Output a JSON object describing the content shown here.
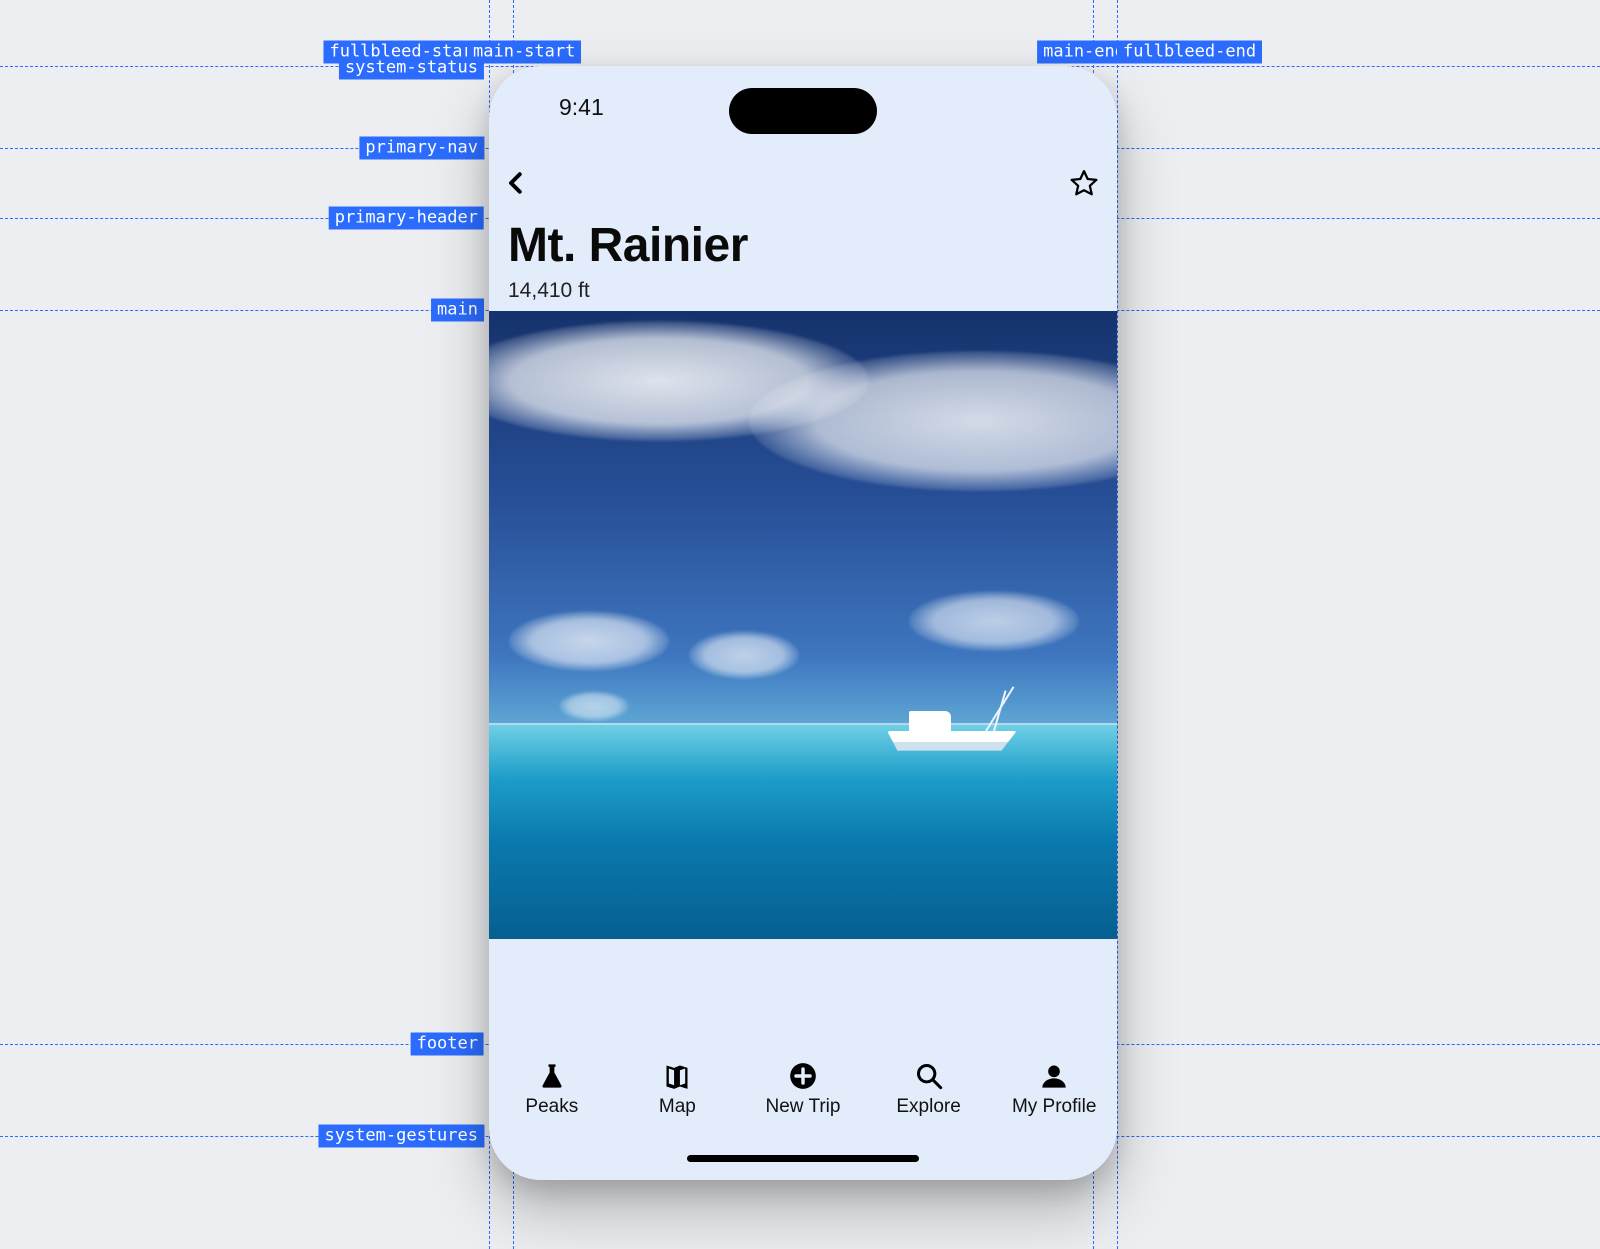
{
  "status": {
    "time": "9:41"
  },
  "header": {
    "title": "Mt. Rainier",
    "subtitle": "14,410 ft"
  },
  "tabs": [
    {
      "label": "Peaks"
    },
    {
      "label": "Map"
    },
    {
      "label": "New Trip"
    },
    {
      "label": "Explore"
    },
    {
      "label": "My Profile"
    }
  ],
  "guides": {
    "fullbleed_left": "fullbleed-start",
    "fullbleed_right": "fullbleed-end",
    "main_left": "main-start",
    "main_right": "main-end",
    "system_status": "system-status",
    "primary_nav": "primary-nav",
    "primary_header": "primary-header",
    "main": "main",
    "footer": "footer",
    "system_gestures": "system-gestures"
  }
}
